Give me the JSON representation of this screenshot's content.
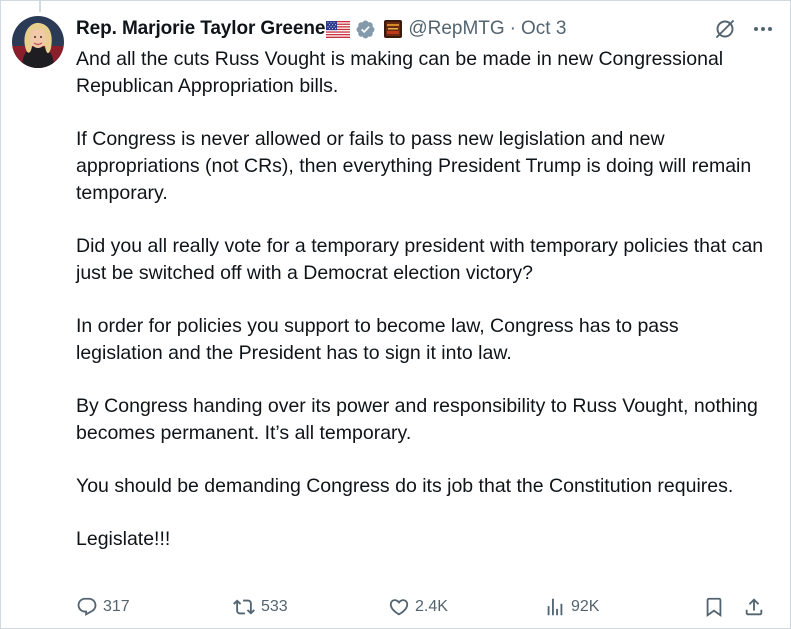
{
  "author": {
    "display_name": "Rep. Marjorie Taylor Greene",
    "handle": "@RepMTG",
    "separator": "·",
    "time": "Oct 3",
    "flag_icon": "us-flag-icon",
    "verified_icon": "verified-badge-icon",
    "affiliation_icon": "affiliation-badge-icon"
  },
  "tweet": {
    "paragraphs": [
      "And all the cuts Russ Vought is making can be made in new Congressional Republican Appropriation bills.",
      "If Congress is never allowed or fails to pass new legislation and new appropriations (not CRs), then everything President Trump is doing will remain temporary.",
      "Did you all really vote for a temporary president with temporary policies that can just be switched off with a Democrat election victory?",
      "In order for policies you support to become law, Congress has to pass legislation and the President has to sign it into law.",
      "By Congress handing over its power and responsibility to Russ Vought, nothing becomes permanent. It’s all temporary.",
      "You should be demanding Congress do its job that the Constitution requires.",
      "Legislate!!!"
    ]
  },
  "actions": {
    "replies": "317",
    "reposts": "533",
    "likes": "2.4K",
    "views": "92K"
  },
  "colors": {
    "text": "#0f1419",
    "secondary": "#536471",
    "verified": "#829aab",
    "border": "#cfd9de"
  }
}
